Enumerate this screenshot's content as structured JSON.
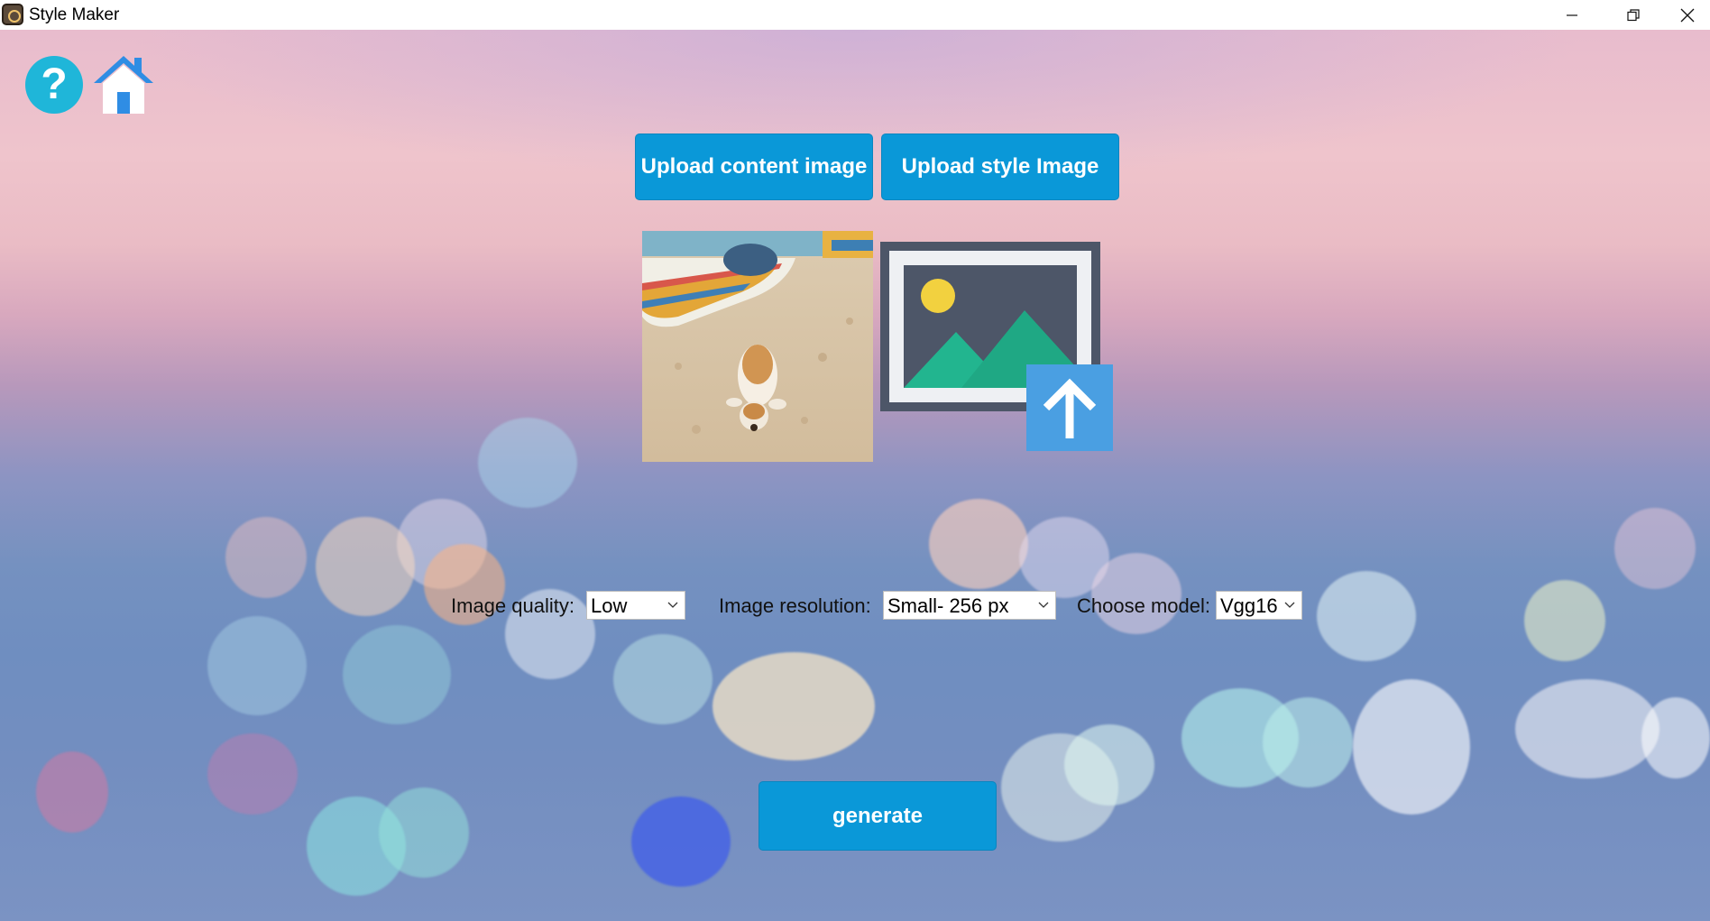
{
  "window": {
    "title": "Style Maker",
    "minimize_icon": "minimize-icon",
    "maximize_icon": "restore-icon",
    "close_icon": "close-icon"
  },
  "toolbar": {
    "help_icon": "help-icon",
    "help_glyph": "?",
    "home_icon": "home-icon"
  },
  "uploads": {
    "content_label": "Upload content image",
    "style_label": "Upload style Image",
    "content_image": "beach-dog-photo",
    "style_image_placeholder": "image-upload-icon"
  },
  "settings": {
    "quality_label": "Image quality:",
    "quality_value": "Low",
    "resolution_label": "Image resolution:",
    "resolution_value": "Small- 256 px",
    "model_label": "Choose model:",
    "model_value": "Vgg16"
  },
  "actions": {
    "generate_label": "generate"
  },
  "colors": {
    "button": "#0a98d8",
    "help_icon": "#1fb6d9",
    "home_icon": "#2f8de4",
    "upload_arrow_bg": "#4a9fe2",
    "placeholder_frame": "#4d5668",
    "placeholder_mountain": "#22b58f",
    "placeholder_sun": "#f2d13f"
  }
}
